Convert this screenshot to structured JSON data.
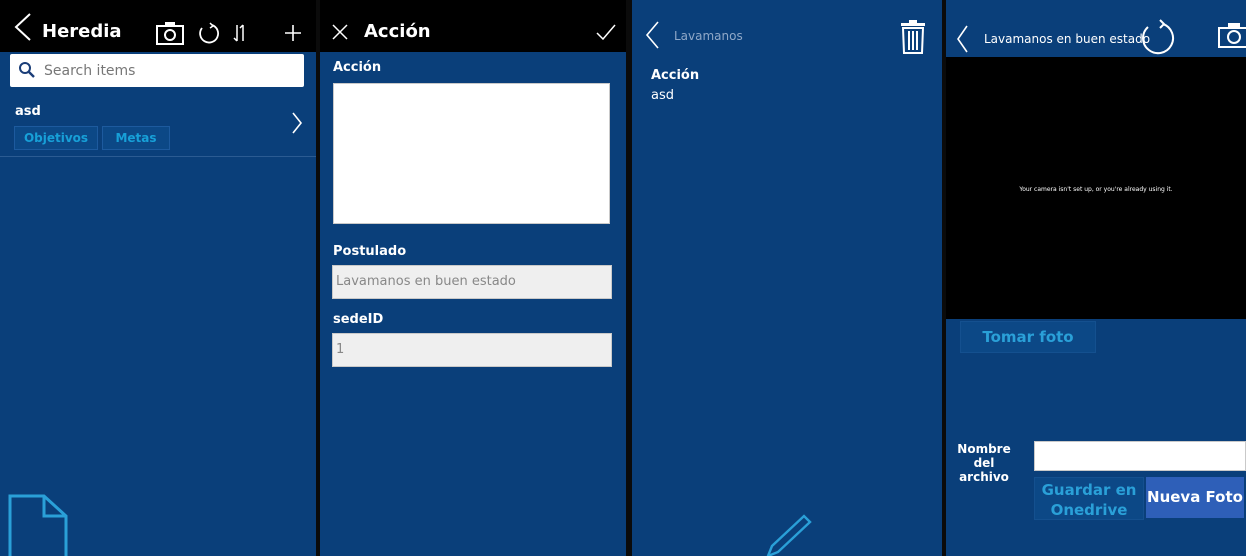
{
  "screen1": {
    "title": "Heredia",
    "search": {
      "placeholder": "Search items"
    },
    "list": [
      {
        "title": "asd",
        "tags": [
          "Objetivos",
          "Metas"
        ]
      }
    ]
  },
  "screen2": {
    "title": "Acción",
    "fields": {
      "accion": {
        "label": "Acción",
        "value": ""
      },
      "postulado": {
        "label": "Postulado",
        "value": "Lavamanos en buen estado"
      },
      "sede": {
        "label": "sedeID",
        "value": "1"
      }
    }
  },
  "screen3": {
    "title": "Lavamanos",
    "detail": {
      "label": "Acción",
      "value": "asd"
    }
  },
  "screen4": {
    "title": "Lavamanos en buen estado",
    "camera_message": "Your camera isn't set up, or you're already using it.",
    "take_photo": "Tomar foto",
    "filename_label": "Nombre del archivo",
    "filename_value": "",
    "save_onedrive": "Guardar en Onedrive",
    "new_photo": "Nueva Foto"
  },
  "colors": {
    "panel": "#0a3f7a",
    "header": "#000000",
    "accent": "#17a0d8"
  }
}
